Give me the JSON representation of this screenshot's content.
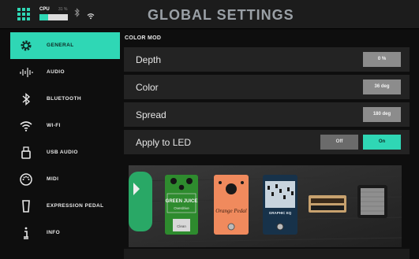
{
  "topbar": {
    "cpu_label": "CPU",
    "cpu_percent_text": "31 %",
    "cpu_load": 0.31,
    "title": "GLOBAL SETTINGS",
    "icons": [
      "grid-icon",
      "bluetooth-icon",
      "wifi-icon"
    ]
  },
  "sidebar": {
    "items": [
      {
        "label": "GENERAL",
        "icon": "gear-icon"
      },
      {
        "label": "AUDIO",
        "icon": "waveform-icon"
      },
      {
        "label": "BLUETOOTH",
        "icon": "bluetooth-icon"
      },
      {
        "label": "WI-FI",
        "icon": "wifi-icon"
      },
      {
        "label": "USB AUDIO",
        "icon": "usb-icon"
      },
      {
        "label": "MIDI",
        "icon": "midi-icon"
      },
      {
        "label": "EXPRESSION PEDAL",
        "icon": "expression-pedal-icon"
      },
      {
        "label": "INFO",
        "icon": "info-icon"
      }
    ],
    "active_index": 0
  },
  "main": {
    "section_title": "COLOR MOD",
    "rows": [
      {
        "label": "Depth",
        "value": "0 %"
      },
      {
        "label": "Color",
        "value": "36 deg"
      },
      {
        "label": "Spread",
        "value": "180 deg"
      }
    ],
    "apply_led": {
      "label": "Apply to LED",
      "off": "Off",
      "on": "On",
      "selected": "On"
    }
  },
  "pedals": {
    "green_pedal": "GREEN JUICE",
    "green_sub": "Overdrive",
    "green_brand": "Clean",
    "orange_pedal": "Orange Pedal",
    "eq_pedal": "GRAPHIC EQ"
  },
  "colors": {
    "accent": "#2fd7b5",
    "panel": "#232323",
    "button": "#8c8c8c"
  }
}
